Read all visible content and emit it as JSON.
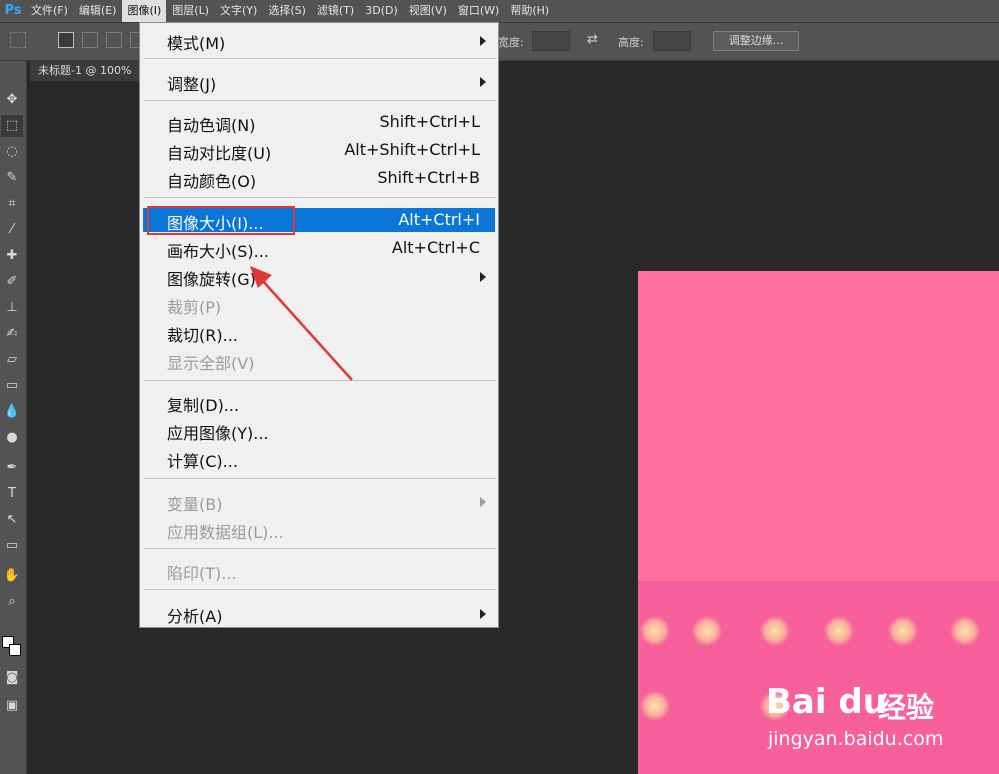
{
  "app": {
    "logo": "Ps"
  },
  "menubar": {
    "items": [
      {
        "label": "文件(F)"
      },
      {
        "label": "编辑(E)"
      },
      {
        "label": "图像(I)"
      },
      {
        "label": "图层(L)"
      },
      {
        "label": "文字(Y)"
      },
      {
        "label": "选择(S)"
      },
      {
        "label": "滤镜(T)"
      },
      {
        "label": "3D(D)"
      },
      {
        "label": "视图(V)"
      },
      {
        "label": "窗口(W)"
      },
      {
        "label": "帮助(H)"
      }
    ]
  },
  "options_bar": {
    "width_label": "宽度:",
    "height_label": "高度:",
    "refine_button": "调整边缘..."
  },
  "document": {
    "tab_title": "未标题-1 @ 100%"
  },
  "image_menu": {
    "items": [
      {
        "label": "模式(M)",
        "shortcut": "",
        "submenu": true,
        "disabled": false
      },
      {
        "label": "调整(J)",
        "shortcut": "",
        "submenu": true,
        "disabled": false
      },
      {
        "label": "自动色调(N)",
        "shortcut": "Shift+Ctrl+L",
        "submenu": false,
        "disabled": false
      },
      {
        "label": "自动对比度(U)",
        "shortcut": "Alt+Shift+Ctrl+L",
        "submenu": false,
        "disabled": false
      },
      {
        "label": "自动颜色(O)",
        "shortcut": "Shift+Ctrl+B",
        "submenu": false,
        "disabled": false
      },
      {
        "label": "图像大小(I)...",
        "shortcut": "Alt+Ctrl+I",
        "submenu": false,
        "disabled": false,
        "highlighted": true
      },
      {
        "label": "画布大小(S)...",
        "shortcut": "Alt+Ctrl+C",
        "submenu": false,
        "disabled": false
      },
      {
        "label": "图像旋转(G)",
        "shortcut": "",
        "submenu": true,
        "disabled": false
      },
      {
        "label": "裁剪(P)",
        "shortcut": "",
        "submenu": false,
        "disabled": true
      },
      {
        "label": "裁切(R)...",
        "shortcut": "",
        "submenu": false,
        "disabled": false
      },
      {
        "label": "显示全部(V)",
        "shortcut": "",
        "submenu": false,
        "disabled": true
      },
      {
        "label": "复制(D)...",
        "shortcut": "",
        "submenu": false,
        "disabled": false
      },
      {
        "label": "应用图像(Y)...",
        "shortcut": "",
        "submenu": false,
        "disabled": false
      },
      {
        "label": "计算(C)...",
        "shortcut": "",
        "submenu": false,
        "disabled": false
      },
      {
        "label": "变量(B)",
        "shortcut": "",
        "submenu": true,
        "disabled": true
      },
      {
        "label": "应用数据组(L)...",
        "shortcut": "",
        "submenu": false,
        "disabled": true
      },
      {
        "label": "陷印(T)...",
        "shortcut": "",
        "submenu": false,
        "disabled": true
      },
      {
        "label": "分析(A)",
        "shortcut": "",
        "submenu": true,
        "disabled": false
      }
    ]
  },
  "watermark": {
    "brand": "Bai du",
    "name": "经验",
    "url": "jingyan.baidu.com"
  },
  "colors": {
    "highlight": "#0a76d8",
    "annotation": "#e0373b",
    "canvas": "#ff6f9f"
  }
}
